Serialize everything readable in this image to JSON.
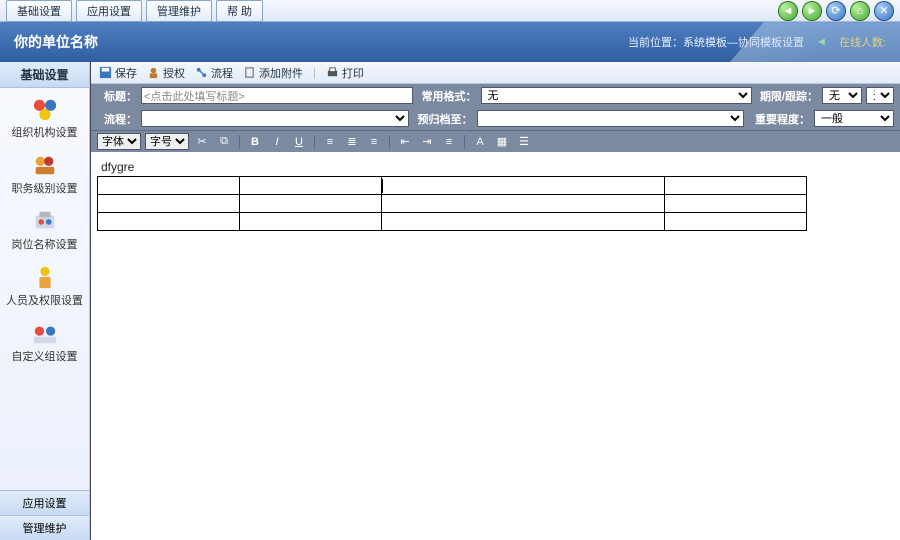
{
  "menu": {
    "items": [
      "基础设置",
      "应用设置",
      "管理维护",
      "帮 助"
    ]
  },
  "banner": {
    "title": "你的单位名称",
    "location_label": "当前位置：",
    "location_path": "系统模板—协同模板设置",
    "online_label": "在线人数:"
  },
  "sidebar": {
    "active_tab": "基础设置",
    "items": [
      {
        "label": "组织机构设置"
      },
      {
        "label": "职务级别设置"
      },
      {
        "label": "岗位名称设置"
      },
      {
        "label": "人员及权限设置"
      },
      {
        "label": "自定义组设置"
      }
    ],
    "bottom_tabs": [
      "应用设置",
      "管理维护"
    ]
  },
  "toolbar": {
    "save": "保存",
    "auth": "授权",
    "flow": "流程",
    "attach": "添加附件",
    "print": "打印"
  },
  "form": {
    "title_label": "标题：",
    "title_placeholder": "<点击此处填写标题>",
    "format_label": "常用格式：",
    "format_value": "无",
    "deadline_label": "期限/跟踪：",
    "deadline_value": "无",
    "deadline_value2": "无",
    "flow_label": "流程：",
    "archive_label": "预归档至：",
    "importance_label": "重要程度：",
    "importance_value": "一般"
  },
  "editbar": {
    "font_label": "字体",
    "size_label": "字号"
  },
  "editor": {
    "text": "dfygre"
  }
}
